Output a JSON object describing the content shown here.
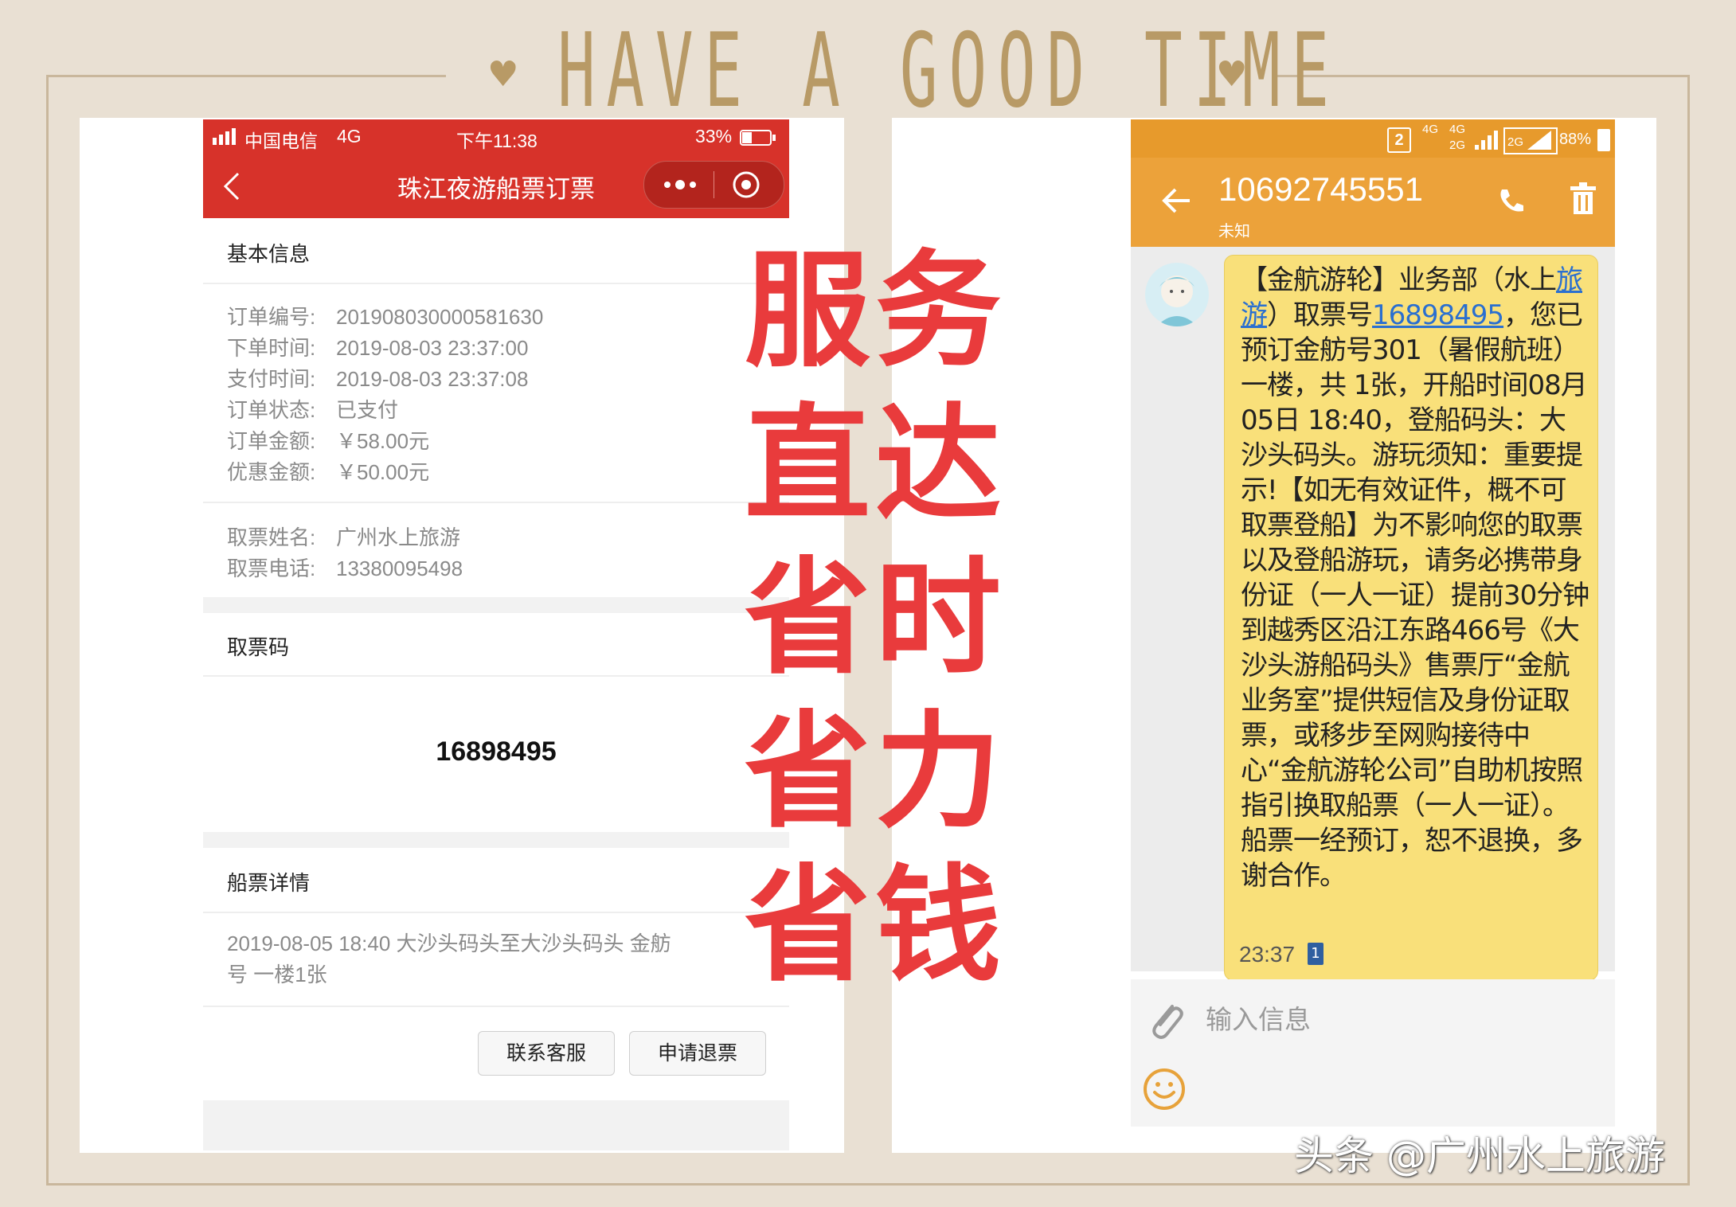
{
  "header": {
    "title": "HAVE A GOOD TIME"
  },
  "left_phone": {
    "status": {
      "carrier": "中国电信",
      "network": "4G",
      "time": "下午11:38",
      "battery": "33%"
    },
    "nav": {
      "title": "珠江夜游船票订票",
      "back_icon": "chevron-left-icon",
      "more_icon": "more-dots-icon",
      "close_icon": "target-icon"
    },
    "basic_info": {
      "title": "基本信息",
      "rows": [
        {
          "key": "订单编号:",
          "value": "201908030000581630"
        },
        {
          "key": "下单时间:",
          "value": "2019-08-03 23:37:00"
        },
        {
          "key": "支付时间:",
          "value": "2019-08-03 23:37:08"
        },
        {
          "key": "订单状态:",
          "value": "已支付"
        },
        {
          "key": "订单金额:",
          "value": "￥58.00元"
        },
        {
          "key": "优惠金额:",
          "value": "￥50.00元"
        }
      ]
    },
    "pickup": {
      "rows": [
        {
          "key": "取票姓名:",
          "value": "广州水上旅游"
        },
        {
          "key": "取票电话:",
          "value": "13380095498"
        }
      ]
    },
    "code_section": {
      "title": "取票码",
      "code": "16898495"
    },
    "ticket_section": {
      "title": "船票详情",
      "line1": "2019-08-05   18:40   大沙头码头至大沙头码头   金舫",
      "line2": "号   一楼1张"
    },
    "buttons": {
      "contact": "联系客服",
      "refund": "申请退票"
    }
  },
  "slogan": {
    "lines": [
      "服务",
      "直达",
      "省时",
      "省力",
      "省钱"
    ],
    "color": "#e93b3c"
  },
  "right_phone": {
    "status": {
      "sim": "2",
      "net1": "4G",
      "net2": "4G",
      "net3": "2G",
      "net4": "2G",
      "battery": "88%"
    },
    "header": {
      "number": "10692745551",
      "sub": "未知",
      "back_icon": "arrow-left-icon",
      "call_icon": "phone-icon",
      "delete_icon": "trash-icon"
    },
    "message": {
      "p1": "【金航游轮】业务部（水上",
      "link1": "旅游",
      "p2": "）取票号",
      "link2": "16898495",
      "p3": "，您已预订金舫号301（暑假航班）一楼，共 1张，开船时间08月05日 18:40，登船码头：大沙头码头。游玩须知：重要提示!【如无有效证件，概不可取票登船】为不影响您的取票以及登船游玩，请务必携带身份证（一人一证）提前30分钟到越秀区沿江东路466号《大沙头游船码头》售票厅“金航业务室”提供短信及身份证取票，或移步至网购接待中心“金航游轮公司”自助机按照指引换取船票（一人一证）。船票一经预订，恕不退换，多谢合作。",
      "time": "23:37",
      "sim_badge": "1"
    },
    "input": {
      "placeholder": "输入信息",
      "attach_icon": "paperclip-icon",
      "emoji_icon": "smiley-icon"
    }
  },
  "watermark": "头条 @广州水上旅游"
}
